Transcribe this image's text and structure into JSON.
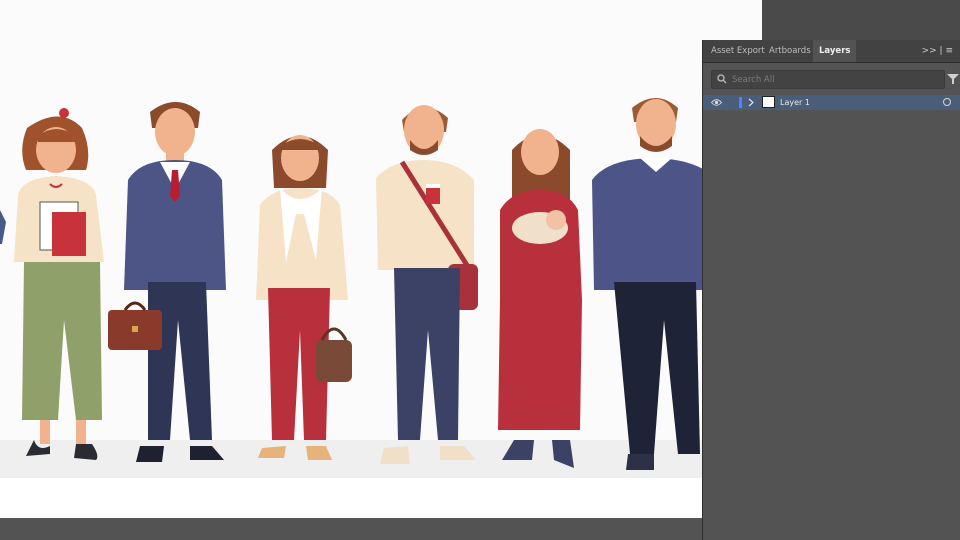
{
  "panel": {
    "tabs": [
      {
        "label": "Asset Export"
      },
      {
        "label": "Artboards"
      },
      {
        "label": "Layers"
      }
    ],
    "menu_label": ">>  |  ≡",
    "search": {
      "placeholder": "Search All",
      "value": ""
    },
    "layers": [
      {
        "name": "Layer 1",
        "visible": true,
        "color": "#4f82ff"
      }
    ]
  },
  "colors": {
    "panel_bg": "#535353",
    "selected_row": "#4b5e79",
    "artboard": "#fbfbfc"
  }
}
